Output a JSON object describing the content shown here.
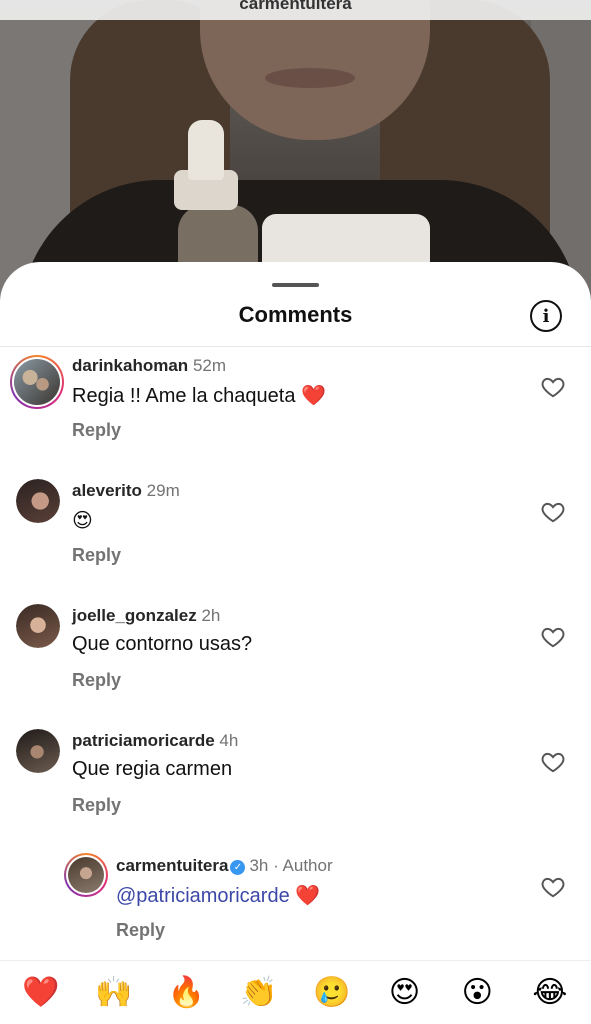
{
  "video": {
    "owner": "carmentuitera"
  },
  "sheet": {
    "title": "Comments",
    "info_icon": "info-icon"
  },
  "comments": [
    {
      "username": "darinkahoman",
      "time": "52m",
      "text": "Regia !! Ame la chaqueta ❤️",
      "reply": "Reply",
      "ring": true
    },
    {
      "username": "aleverito",
      "time": "29m",
      "text": "😍",
      "reply": "Reply",
      "ring": false
    },
    {
      "username": "joelle_gonzalez",
      "time": "2h",
      "text": "Que contorno usas?",
      "reply": "Reply",
      "ring": false
    },
    {
      "username": "patriciamoricarde",
      "time": "4h",
      "text": "Que regia carmen",
      "reply": "Reply",
      "ring": false
    }
  ],
  "reply_comment": {
    "username": "carmentuitera",
    "time": "3h",
    "author_label": "Author",
    "mention": "@patriciamoricarde",
    "text_suffix": "❤️",
    "reply": "Reply"
  },
  "reactions": [
    "❤️",
    "🙌",
    "🔥",
    "👏",
    "🥲",
    "😍",
    "😮",
    "😂"
  ],
  "colors": {
    "mention": "#3b48a8",
    "verified": "#3897f0",
    "reply": "#737373"
  }
}
